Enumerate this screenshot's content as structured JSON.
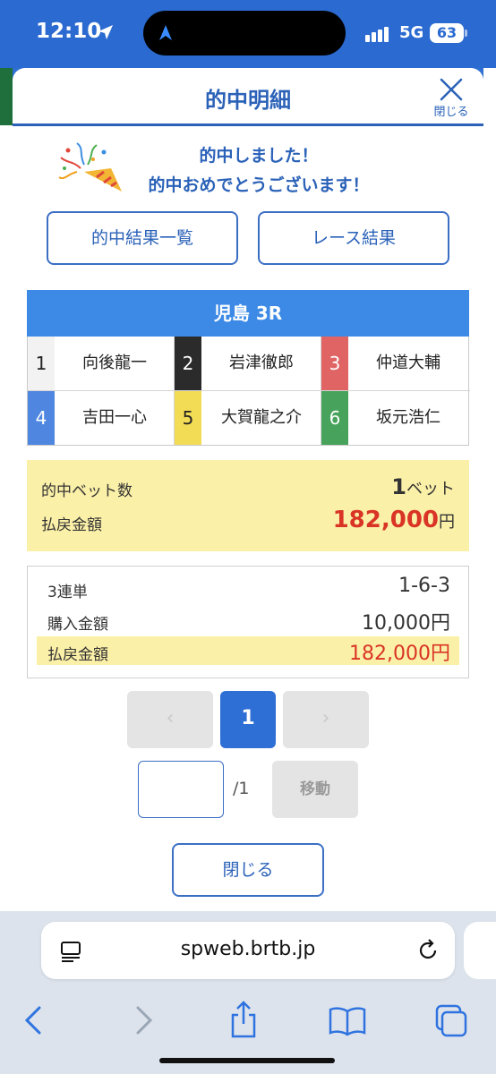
{
  "status": {
    "time": "12:10",
    "network": "5G",
    "battery": "63"
  },
  "modal": {
    "title": "的中明細",
    "close_label": "閉じる",
    "message_line1": "的中しました！",
    "message_line2": "的中おめでとうございます！",
    "btn_hit_list": "的中結果一覧",
    "btn_race_result": "レース結果"
  },
  "race": {
    "header": "児島 3R",
    "racers": [
      {
        "num": "1",
        "name": "向後龍一",
        "bg": "#f2f2f2",
        "fg": "#222222"
      },
      {
        "num": "2",
        "name": "岩津徹郎",
        "bg": "#2b2b2b",
        "fg": "#ffffff"
      },
      {
        "num": "3",
        "name": "仲道大輔",
        "bg": "#e06464",
        "fg": "#ffffff"
      },
      {
        "num": "4",
        "name": "吉田一心",
        "bg": "#4f86e0",
        "fg": "#ffffff"
      },
      {
        "num": "5",
        "name": "大賀龍之介",
        "bg": "#f3dc55",
        "fg": "#222222"
      },
      {
        "num": "6",
        "name": "坂元浩仁",
        "bg": "#47a35b",
        "fg": "#ffffff"
      }
    ]
  },
  "summary": {
    "bets_label": "的中ベット数",
    "bets_value": "1",
    "bets_unit": "ベット",
    "payout_label": "払戻金額",
    "payout_value": "182,000",
    "yen": "円"
  },
  "detail": {
    "bet_type_label": "3連単",
    "bet_combo": "1-6-3",
    "purchase_label": "購入金額",
    "purchase_value": "10,000円",
    "payout_label": "払戻金額",
    "payout_value": "182,000円"
  },
  "pager": {
    "prev": "‹",
    "current": "1",
    "next": "›",
    "total": "/1",
    "move": "移動",
    "close": "閉じる"
  },
  "browser": {
    "url": "spweb.brtb.jp"
  },
  "colors": {
    "brand_blue": "#2b62b8",
    "race_header": "#3c8ae6",
    "highlight": "#fbf0a8",
    "payout_red": "#d93426"
  }
}
